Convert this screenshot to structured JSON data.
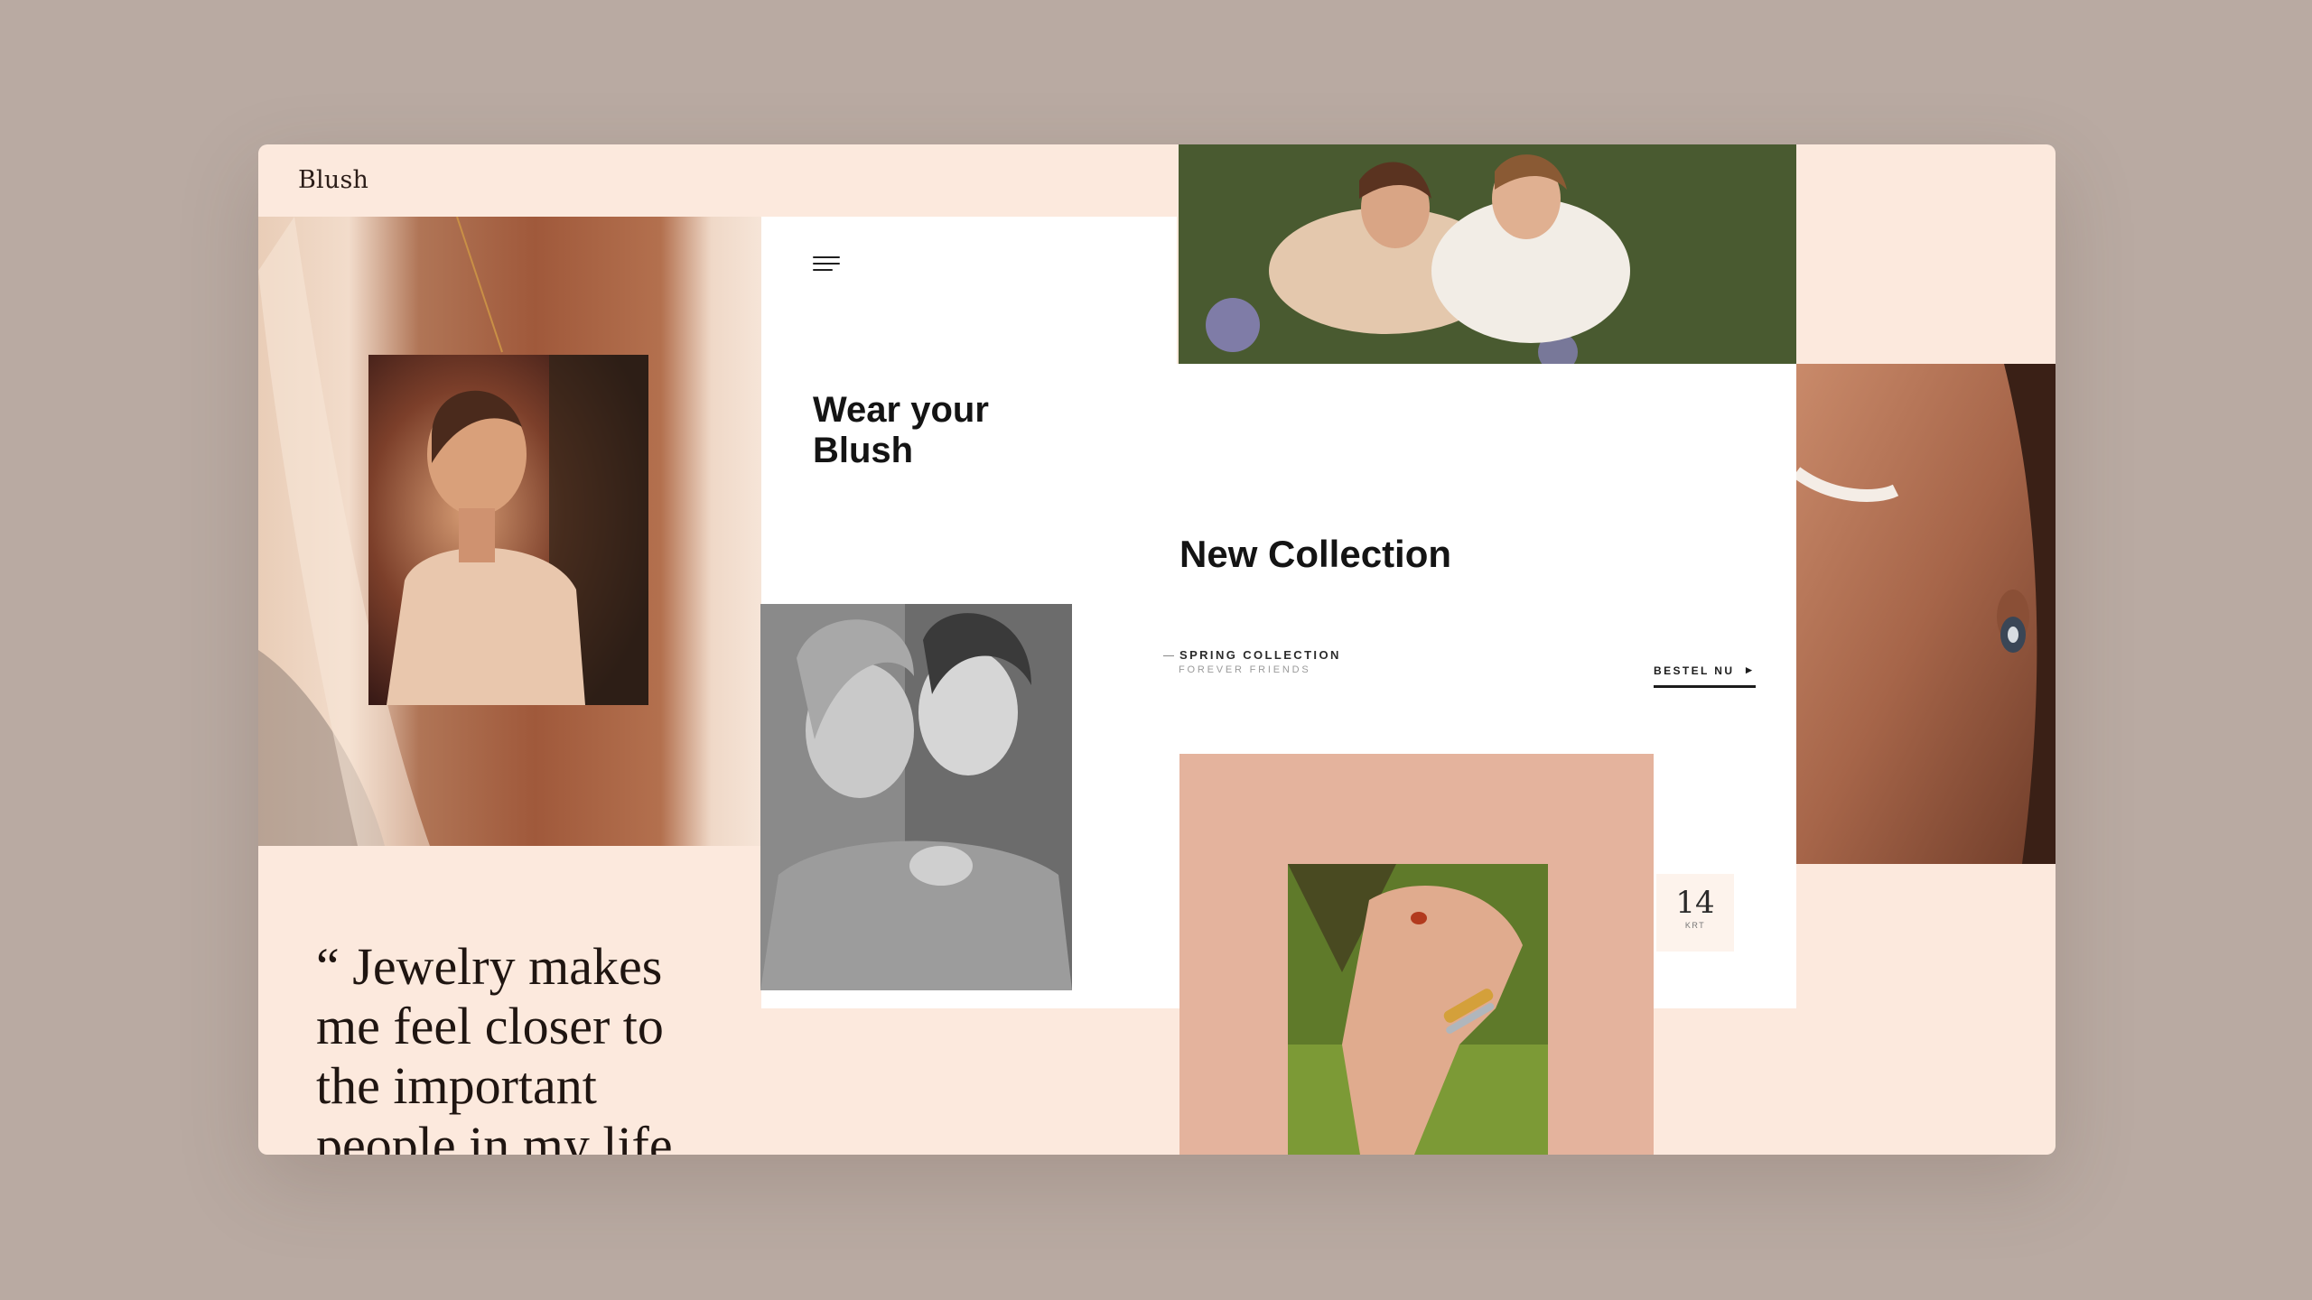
{
  "brand": {
    "name": "Blush"
  },
  "hero": {
    "headline": "Wear your Blush"
  },
  "collection": {
    "title": "New Collection",
    "label": "SPRING COLLECTION",
    "sublabel": "FOREVER FRIENDS",
    "cta": "BESTEL NU"
  },
  "quote": {
    "text": "“ Jewelry makes me feel closer to the important people in my life"
  },
  "product": {
    "carat_value": "14",
    "carat_unit": "KRT"
  },
  "colors": {
    "backdrop": "#b9aaa2",
    "page": "#fce9dd",
    "panel": "#ffffff",
    "rose": "#e4b39d",
    "text": "#141414"
  },
  "icons": {
    "menu": "hamburger-menu-icon",
    "cta_arrow": "chevron-right-icon"
  }
}
